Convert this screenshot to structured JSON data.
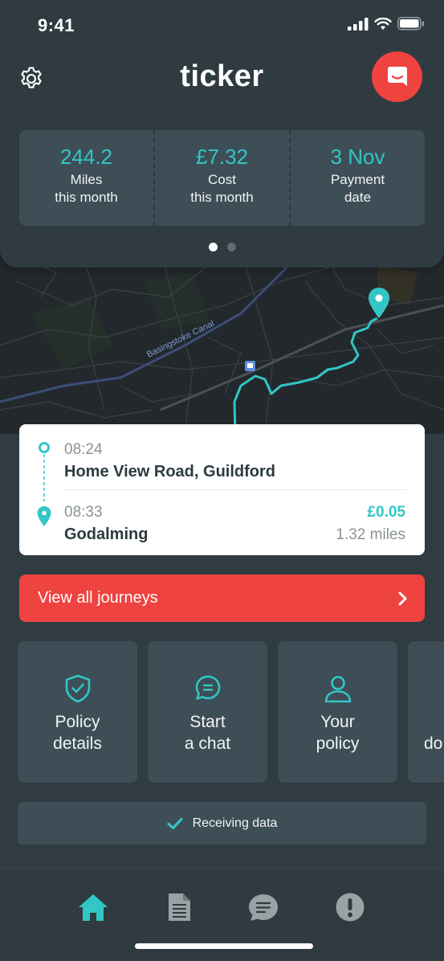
{
  "status_bar": {
    "time": "9:41"
  },
  "header": {
    "logo": "ticker"
  },
  "stats": [
    {
      "value": "244.2",
      "label_line1": "Miles",
      "label_line2": "this month"
    },
    {
      "value": "£7.32",
      "label_line1": "Cost",
      "label_line2": "this month"
    },
    {
      "value": "3 Nov",
      "label_line1": "Payment",
      "label_line2": "date"
    }
  ],
  "carousel": {
    "pages": 2,
    "active": 1
  },
  "map": {
    "road_label": "Basingstoke Canal"
  },
  "journey": {
    "start_time": "08:24",
    "start_place": "Home View Road, Guildford",
    "end_time": "08:33",
    "end_place": "Godalming",
    "cost": "£0.05",
    "distance": "1.32 miles"
  },
  "view_all": {
    "label": "View all journeys"
  },
  "tiles": [
    {
      "line1": "Policy",
      "line2": "details",
      "icon": "shield-check-icon"
    },
    {
      "line1": "Start",
      "line2": "a chat",
      "icon": "chat-bubble-icon"
    },
    {
      "line1": "Your",
      "line2": "policy",
      "icon": "person-icon"
    },
    {
      "line1": "",
      "line2": "do",
      "icon": ""
    }
  ],
  "receiving": {
    "label": "Receiving data"
  },
  "colors": {
    "accent": "#32c6c6",
    "brand_red": "#ef4340",
    "background": "#303b42",
    "panel": "#3e4e56"
  }
}
